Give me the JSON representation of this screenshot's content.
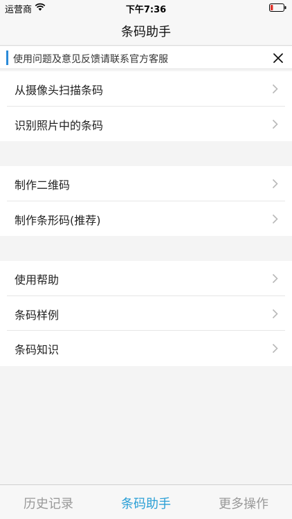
{
  "status": {
    "carrier": "运营商",
    "time": "下午7:36"
  },
  "nav": {
    "title": "条码助手"
  },
  "notice": {
    "text": "使用问题及意见反馈请联系官方客服"
  },
  "groups": [
    {
      "items": [
        {
          "label": "从摄像头扫描条码"
        },
        {
          "label": "识别照片中的条码"
        }
      ]
    },
    {
      "items": [
        {
          "label": "制作二维码"
        },
        {
          "label": "制作条形码(推荐)"
        }
      ]
    },
    {
      "items": [
        {
          "label": "使用帮助"
        },
        {
          "label": "条码样例"
        },
        {
          "label": "条码知识"
        }
      ]
    }
  ],
  "tabs": [
    {
      "label": "历史记录"
    },
    {
      "label": "条码助手"
    },
    {
      "label": "更多操作"
    }
  ],
  "colors": {
    "accent": "#2a9fd6",
    "notice_bar": "#2a8ad8",
    "battery_low": "#e0342c"
  }
}
